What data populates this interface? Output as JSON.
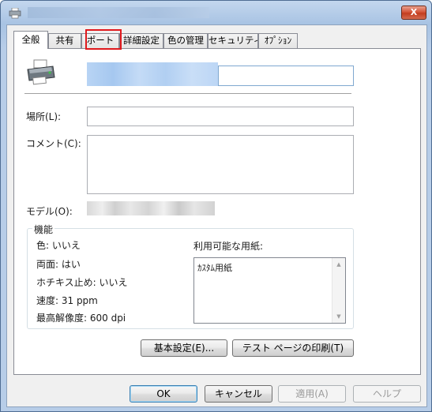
{
  "window": {
    "tabs": [
      {
        "label": "全般"
      },
      {
        "label": "共有"
      },
      {
        "label": "ポート"
      },
      {
        "label": "詳細設定"
      },
      {
        "label": "色の管理"
      },
      {
        "label": "セキュリティ"
      },
      {
        "label": "ｵﾌﾟｼｮﾝ"
      }
    ],
    "close_label": "X"
  },
  "general": {
    "location_label": "場所(L):",
    "location_value": "",
    "comment_label": "コメント(C):",
    "comment_value": "",
    "model_label": "モデル(O):"
  },
  "features": {
    "title": "機能",
    "color": "色: いいえ",
    "duplex": "両面: はい",
    "staple": "ホチキス止め: いいえ",
    "speed": "速度: 31 ppm",
    "resolution": "最高解像度: 600 dpi",
    "paper_label": "利用可能な用紙:",
    "paper_items": [
      "ｶｽﾀﾑ用紙"
    ]
  },
  "buttons": {
    "preferences": "基本設定(E)...",
    "test_page": "テスト ページの印刷(T)",
    "ok": "OK",
    "cancel": "キャンセル",
    "apply": "適用(A)",
    "help": "ヘルプ"
  },
  "colors": {
    "highlight": "#e0191d",
    "close_button": "#c23d1f"
  },
  "icons": [
    "printer-icon",
    "close-icon",
    "scroll-up-icon",
    "scroll-down-icon"
  ]
}
